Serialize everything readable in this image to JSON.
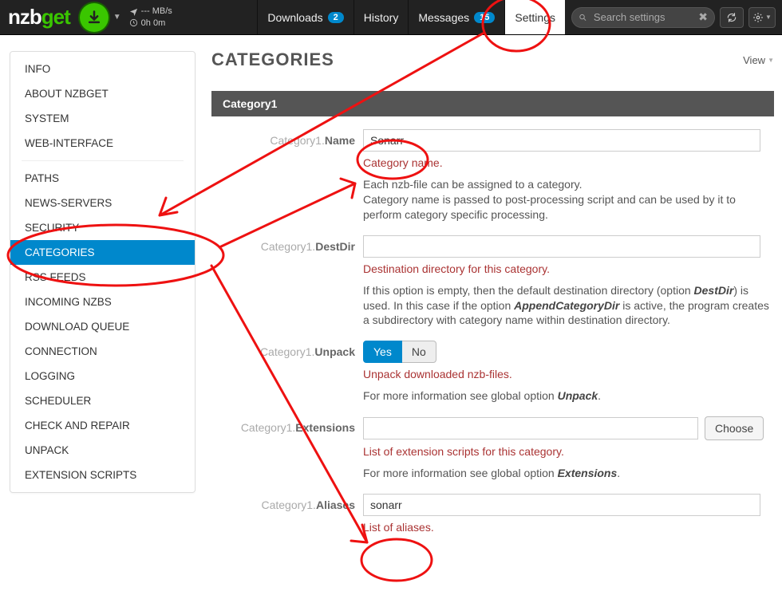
{
  "topbar": {
    "logo1": "nzb",
    "logo2": "get",
    "speed_value": "--- MB/s",
    "time_value": "0h 0m",
    "nav": {
      "downloads": {
        "label": "Downloads",
        "badge": "2"
      },
      "history": {
        "label": "History"
      },
      "messages": {
        "label": "Messages",
        "badge": "15"
      },
      "settings": {
        "label": "Settings"
      }
    },
    "search_placeholder": "Search settings"
  },
  "sidebar": [
    "INFO",
    "ABOUT NZBGET",
    "SYSTEM",
    "WEB-INTERFACE",
    "---",
    "PATHS",
    "NEWS-SERVERS",
    "SECURITY",
    "CATEGORIES",
    "RSS FEEDS",
    "INCOMING NZBS",
    "DOWNLOAD QUEUE",
    "CONNECTION",
    "LOGGING",
    "SCHEDULER",
    "CHECK AND REPAIR",
    "UNPACK",
    "EXTENSION SCRIPTS"
  ],
  "sidebar_active": "CATEGORIES",
  "content": {
    "title": "CATEGORIES",
    "view": "View",
    "section": "Category1",
    "cat_prefix": "Category1.",
    "name": {
      "label": "Name",
      "value": "Sonarr",
      "help_red": "Category name.",
      "help_gray": "Each nzb-file can be assigned to a category.\nCategory name is passed to post-processing script and can be used by it to perform category specific processing."
    },
    "destdir": {
      "label": "DestDir",
      "value": "",
      "help_red": "Destination directory for this category.",
      "help_prefix": "If this option is empty, then the default destination directory (option ",
      "destdir_word": "DestDir",
      "help_mid": ") is used. In this case if the option ",
      "appcat_word": "AppendCategoryDir",
      "help_suffix": " is active, the program creates a subdirectory with category name within destination directory."
    },
    "unpack": {
      "label": "Unpack",
      "yes": "Yes",
      "no": "No",
      "help_red": "Unpack downloaded nzb-files.",
      "help_prefix": "For more information see global option ",
      "opt_word": "Unpack",
      "help_suffix": "."
    },
    "extensions": {
      "label": "Extensions",
      "value": "",
      "choose": "Choose",
      "help_red": "List of extension scripts for this category.",
      "help_prefix": "For more information see global option ",
      "opt_word": "Extensions",
      "help_suffix": "."
    },
    "aliases": {
      "label": "Aliases",
      "value": "sonarr",
      "help_red": "List of aliases."
    }
  }
}
